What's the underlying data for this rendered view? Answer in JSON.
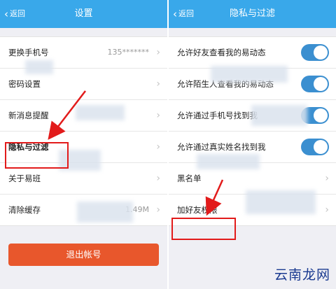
{
  "left": {
    "nav": {
      "back_label": "返回",
      "title": "设置"
    },
    "items": [
      {
        "label": "更换手机号",
        "value": "135*******"
      },
      {
        "label": "密码设置"
      },
      {
        "label": "新消息提醒"
      },
      {
        "label": "隐私与过滤"
      },
      {
        "label": "关于易班"
      },
      {
        "label": "清除缓存",
        "value": "1.49M"
      }
    ],
    "logout_label": "退出帐号"
  },
  "right": {
    "nav": {
      "back_label": "返回",
      "title": "隐私与过滤"
    },
    "items": [
      {
        "label": "允许好友查看我的易动态",
        "toggle": true
      },
      {
        "label": "允许陌生人查看我的易动态",
        "toggle": true
      },
      {
        "label": "允许通过手机号找到我",
        "toggle": true
      },
      {
        "label": "允许通过真实姓名找到我",
        "toggle": true
      },
      {
        "label": "黑名单"
      },
      {
        "label": "加好友权限"
      }
    ]
  },
  "watermark": "云南龙网",
  "colors": {
    "nav": "#39a8ea",
    "toggle_on": "#3b8fd0",
    "logout": "#e8572c",
    "highlight": "#e21b1b"
  }
}
